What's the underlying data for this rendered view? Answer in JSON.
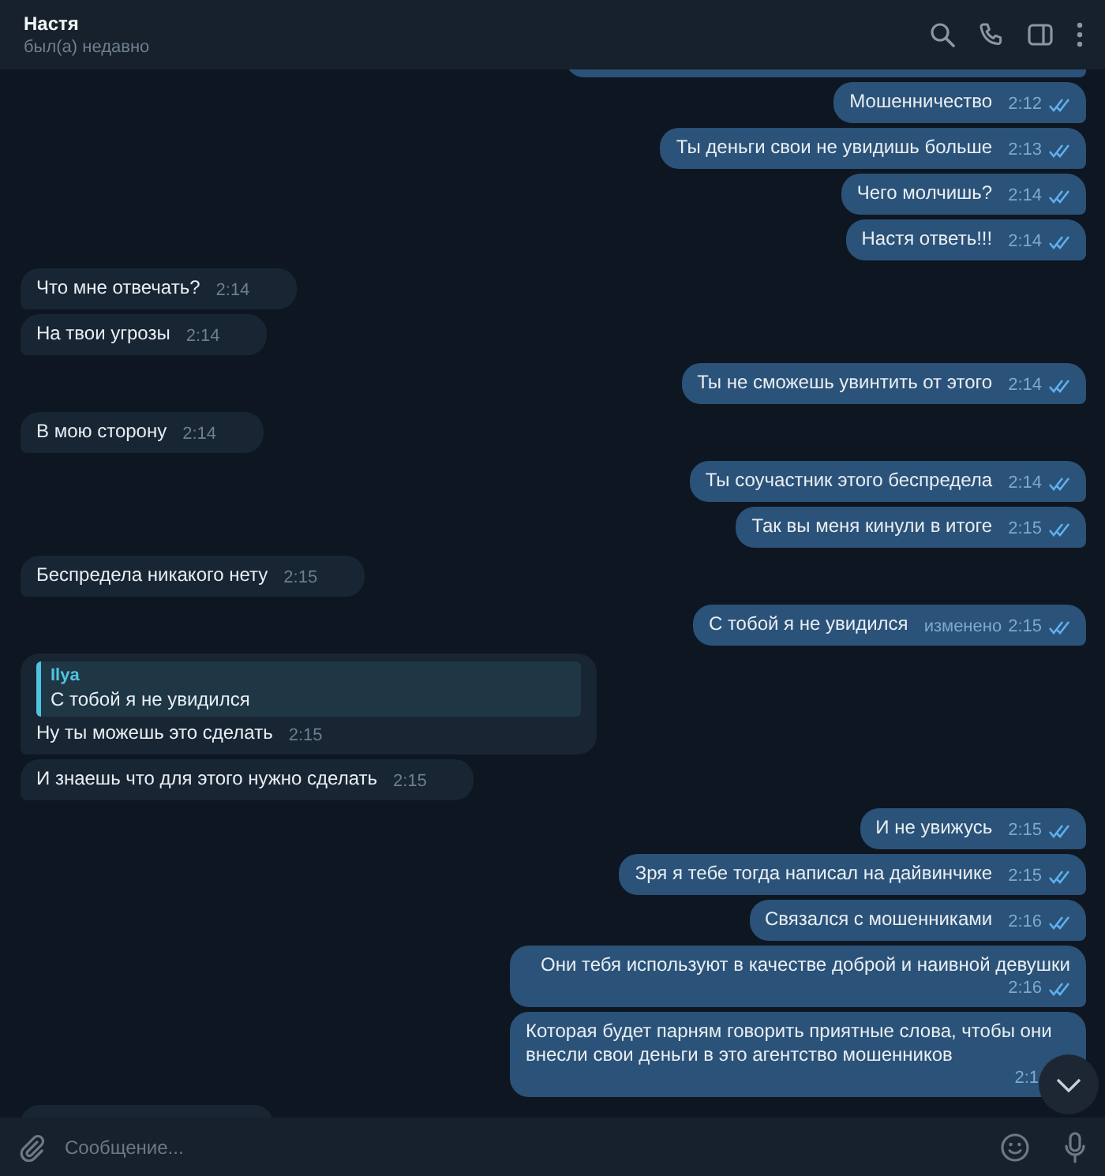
{
  "header": {
    "title": "Настя",
    "status": "был(а) недавно"
  },
  "messages": [
    {
      "kind": "cut",
      "outgoing": true
    },
    {
      "kind": "text",
      "outgoing": true,
      "text": "Мошенничество",
      "time": "2:12",
      "read": true
    },
    {
      "kind": "text",
      "outgoing": true,
      "text": "Ты деньги свои не увидишь больше",
      "time": "2:13",
      "read": true
    },
    {
      "kind": "text",
      "outgoing": true,
      "text": "Чего молчишь?",
      "time": "2:14",
      "read": true
    },
    {
      "kind": "text",
      "outgoing": true,
      "text": "Настя ответь!!!",
      "time": "2:14",
      "read": true
    },
    {
      "kind": "text",
      "outgoing": false,
      "text": "Что мне отвечать?",
      "time": "2:14"
    },
    {
      "kind": "text",
      "outgoing": false,
      "text": "На твои угрозы",
      "time": "2:14"
    },
    {
      "kind": "text",
      "outgoing": true,
      "text": "Ты не сможешь увинтить от этого",
      "time": "2:14",
      "read": true
    },
    {
      "kind": "text",
      "outgoing": false,
      "text": "В мою сторону",
      "time": "2:14"
    },
    {
      "kind": "text",
      "outgoing": true,
      "text": "Ты соучастник этого беспредела",
      "time": "2:14",
      "read": true
    },
    {
      "kind": "text",
      "outgoing": true,
      "text": "Так вы меня кинули в итоге",
      "time": "2:15",
      "read": true
    },
    {
      "kind": "text",
      "outgoing": false,
      "text": "Беспредела никакого нету",
      "time": "2:15"
    },
    {
      "kind": "text",
      "outgoing": true,
      "text": "С тобой я не увидился",
      "time": "2:15",
      "read": true,
      "edited": "изменено"
    },
    {
      "kind": "text",
      "outgoing": false,
      "reply": {
        "author": "Ilya",
        "text": "С тобой я не увидился"
      },
      "text": "Ну ты можешь это сделать",
      "time": "2:15"
    },
    {
      "kind": "text",
      "outgoing": false,
      "text": "И знаешь что для этого нужно сделать",
      "time": "2:15"
    },
    {
      "kind": "text",
      "outgoing": true,
      "text": "И не увижусь",
      "time": "2:15",
      "read": true
    },
    {
      "kind": "text",
      "outgoing": true,
      "text": "Зря я тебе тогда написал на дайвинчике",
      "time": "2:15",
      "read": true
    },
    {
      "kind": "text",
      "outgoing": true,
      "text": "Связался с мошенниками",
      "time": "2:16",
      "read": true
    },
    {
      "kind": "text",
      "outgoing": true,
      "text": "Они тебя используют в качестве доброй и наивной девушки",
      "time": "2:16",
      "read": true
    },
    {
      "kind": "text",
      "outgoing": true,
      "text": "Которая будет парням говорить приятные слова, чтобы они внесли свои деньги в это агентство мошенников",
      "time": "2:1"
    },
    {
      "kind": "cut",
      "outgoing": false
    }
  ],
  "composer": {
    "placeholder": "Сообщение..."
  }
}
